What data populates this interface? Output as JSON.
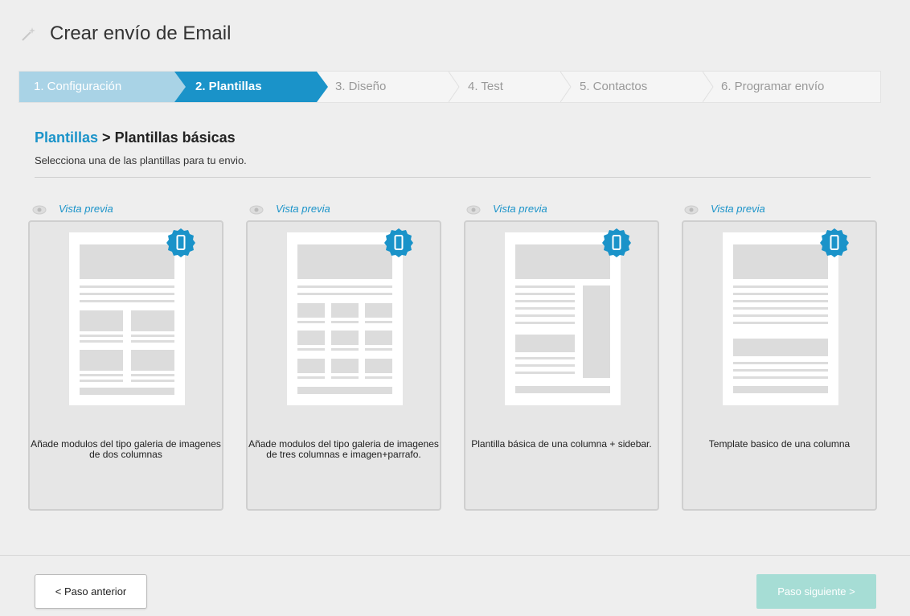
{
  "header": {
    "title": "Crear envío de Email",
    "icon": "magic-wand-icon"
  },
  "steps": [
    {
      "label": "1. Configuración",
      "state": "done"
    },
    {
      "label": "2. Plantillas",
      "state": "active"
    },
    {
      "label": "3. Diseño",
      "state": "pending"
    },
    {
      "label": "4. Test",
      "state": "pending"
    },
    {
      "label": "5. Contactos",
      "state": "pending"
    },
    {
      "label": "6. Programar envío",
      "state": "pending"
    }
  ],
  "breadcrumb": {
    "link": "Plantillas",
    "separator": ">",
    "current": "Plantillas básicas"
  },
  "subtitle": "Selecciona una de las plantillas para tu envio.",
  "templates": [
    {
      "preview_label": "Vista previa",
      "description": "Añade modulos del tipo galeria de imagenes de dos columnas",
      "badge_icon": "mobile-icon"
    },
    {
      "preview_label": "Vista previa",
      "description": "Añade modulos del tipo galeria de imagenes de tres columnas e imagen+parrafo.",
      "badge_icon": "mobile-icon"
    },
    {
      "preview_label": "Vista previa",
      "description": "Plantilla básica de una columna + sidebar.",
      "badge_icon": "mobile-icon"
    },
    {
      "preview_label": "Vista previa",
      "description": "Template basico de una columna",
      "badge_icon": "mobile-icon"
    }
  ],
  "footer": {
    "prev_label": "< Paso anterior",
    "next_label": "Paso siguiente >"
  },
  "colors": {
    "accent": "#1a93c9",
    "step_done": "#a9d3e6",
    "next_button_disabled": "#a6ddd5"
  }
}
